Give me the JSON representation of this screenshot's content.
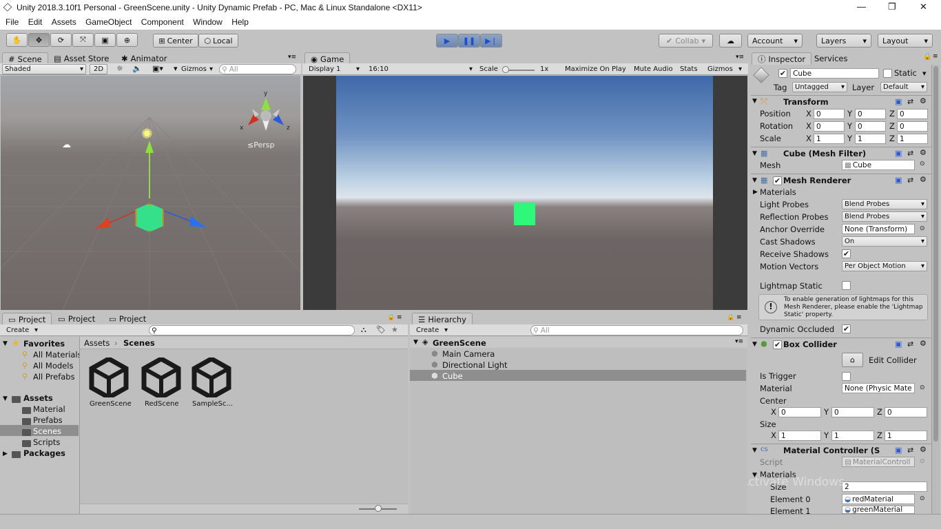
{
  "window": {
    "title": "Unity 2018.3.10f1 Personal - GreenScene.unity - Unity Dynamic Prefab - PC, Mac & Linux Standalone <DX11>"
  },
  "menu": [
    "File",
    "Edit",
    "Assets",
    "GameObject",
    "Component",
    "Window",
    "Help"
  ],
  "toolbar": {
    "pivot": "Center",
    "space": "Local",
    "collab": "Collab",
    "account": "Account",
    "layers": "Layers",
    "layout": "Layout"
  },
  "scene_tabs": [
    "Scene",
    "Asset Store",
    "Animator"
  ],
  "scene_bar": {
    "shading": "Shaded",
    "mode2d": "2D",
    "gizmos": "Gizmos",
    "search_placeholder": "All",
    "persp": "Persp"
  },
  "game": {
    "tab": "Game",
    "display": "Display 1",
    "aspect": "16:10",
    "scale_label": "Scale",
    "scale_value": "1x",
    "maximize": "Maximize On Play",
    "mute": "Mute Audio",
    "stats": "Stats",
    "gizmos": "Gizmos"
  },
  "project": {
    "tabs": [
      "Project",
      "Project",
      "Project"
    ],
    "create": "Create",
    "favorites_label": "Favorites",
    "favorites": [
      "All Materials",
      "All Models",
      "All Prefabs"
    ],
    "assets_label": "Assets",
    "folders": [
      "Material",
      "Prefabs",
      "Scenes",
      "Scripts"
    ],
    "packages_label": "Packages",
    "breadcrumb": [
      "Assets",
      "Scenes"
    ],
    "files": [
      "GreenScene",
      "RedScene",
      "SampleSc..."
    ]
  },
  "hierarchy": {
    "tab": "Hierarchy",
    "create": "Create",
    "search_placeholder": "All",
    "scene": "GreenScene",
    "items": [
      "Main Camera",
      "Directional Light",
      "Cube"
    ]
  },
  "inspector": {
    "tabs": [
      "Inspector",
      "Services"
    ],
    "object_name": "Cube",
    "static_label": "Static",
    "tag_label": "Tag",
    "tag": "Untagged",
    "layer_label": "Layer",
    "layer": "Default",
    "transform": {
      "title": "Transform",
      "rows": [
        {
          "label": "Position",
          "x": "0",
          "y": "0",
          "z": "0"
        },
        {
          "label": "Rotation",
          "x": "0",
          "y": "0",
          "z": "0"
        },
        {
          "label": "Scale",
          "x": "1",
          "y": "1",
          "z": "1"
        }
      ]
    },
    "mesh_filter": {
      "title": "Cube (Mesh Filter)",
      "mesh_label": "Mesh",
      "mesh": "Cube"
    },
    "mesh_renderer": {
      "title": "Mesh Renderer",
      "materials": "Materials",
      "rows": [
        {
          "label": "Light Probes",
          "value": "Blend Probes"
        },
        {
          "label": "Reflection Probes",
          "value": "Blend Probes"
        },
        {
          "label": "Anchor Override",
          "value": "None (Transform)"
        },
        {
          "label": "Cast Shadows",
          "value": "On"
        },
        {
          "label": "Receive Shadows",
          "value": ""
        },
        {
          "label": "Motion Vectors",
          "value": "Per Object Motion"
        }
      ],
      "lightmap_static": "Lightmap Static",
      "info": "To enable generation of lightmaps for this Mesh Renderer, please enable the 'Lightmap Static' property.",
      "dynamic_occluded": "Dynamic Occluded"
    },
    "box_collider": {
      "title": "Box Collider",
      "edit": "Edit Collider",
      "is_trigger": "Is Trigger",
      "material_label": "Material",
      "material": "None (Physic Mate",
      "center_label": "Center",
      "center": {
        "x": "0",
        "y": "0",
        "z": "0"
      },
      "size_label": "Size",
      "size": {
        "x": "1",
        "y": "1",
        "z": "1"
      }
    },
    "material_controller": {
      "title": "Material Controller (S",
      "script_label": "Script",
      "script": "MaterialControll",
      "materials_label": "Materials",
      "size_label": "Size",
      "size": "2",
      "elements": [
        {
          "label": "Element 0",
          "value": "redMaterial"
        },
        {
          "label": "Element 1",
          "value": "greenMaterial"
        }
      ]
    },
    "watermark": "Activate Windows"
  },
  "colors": {
    "bg": "#c2c2c2",
    "sky_top": "#3f6aa9",
    "ground": "#6e6564",
    "cube": "#2ef77a",
    "play_active": "#7d93bb",
    "selection": "#8e8e8e"
  }
}
